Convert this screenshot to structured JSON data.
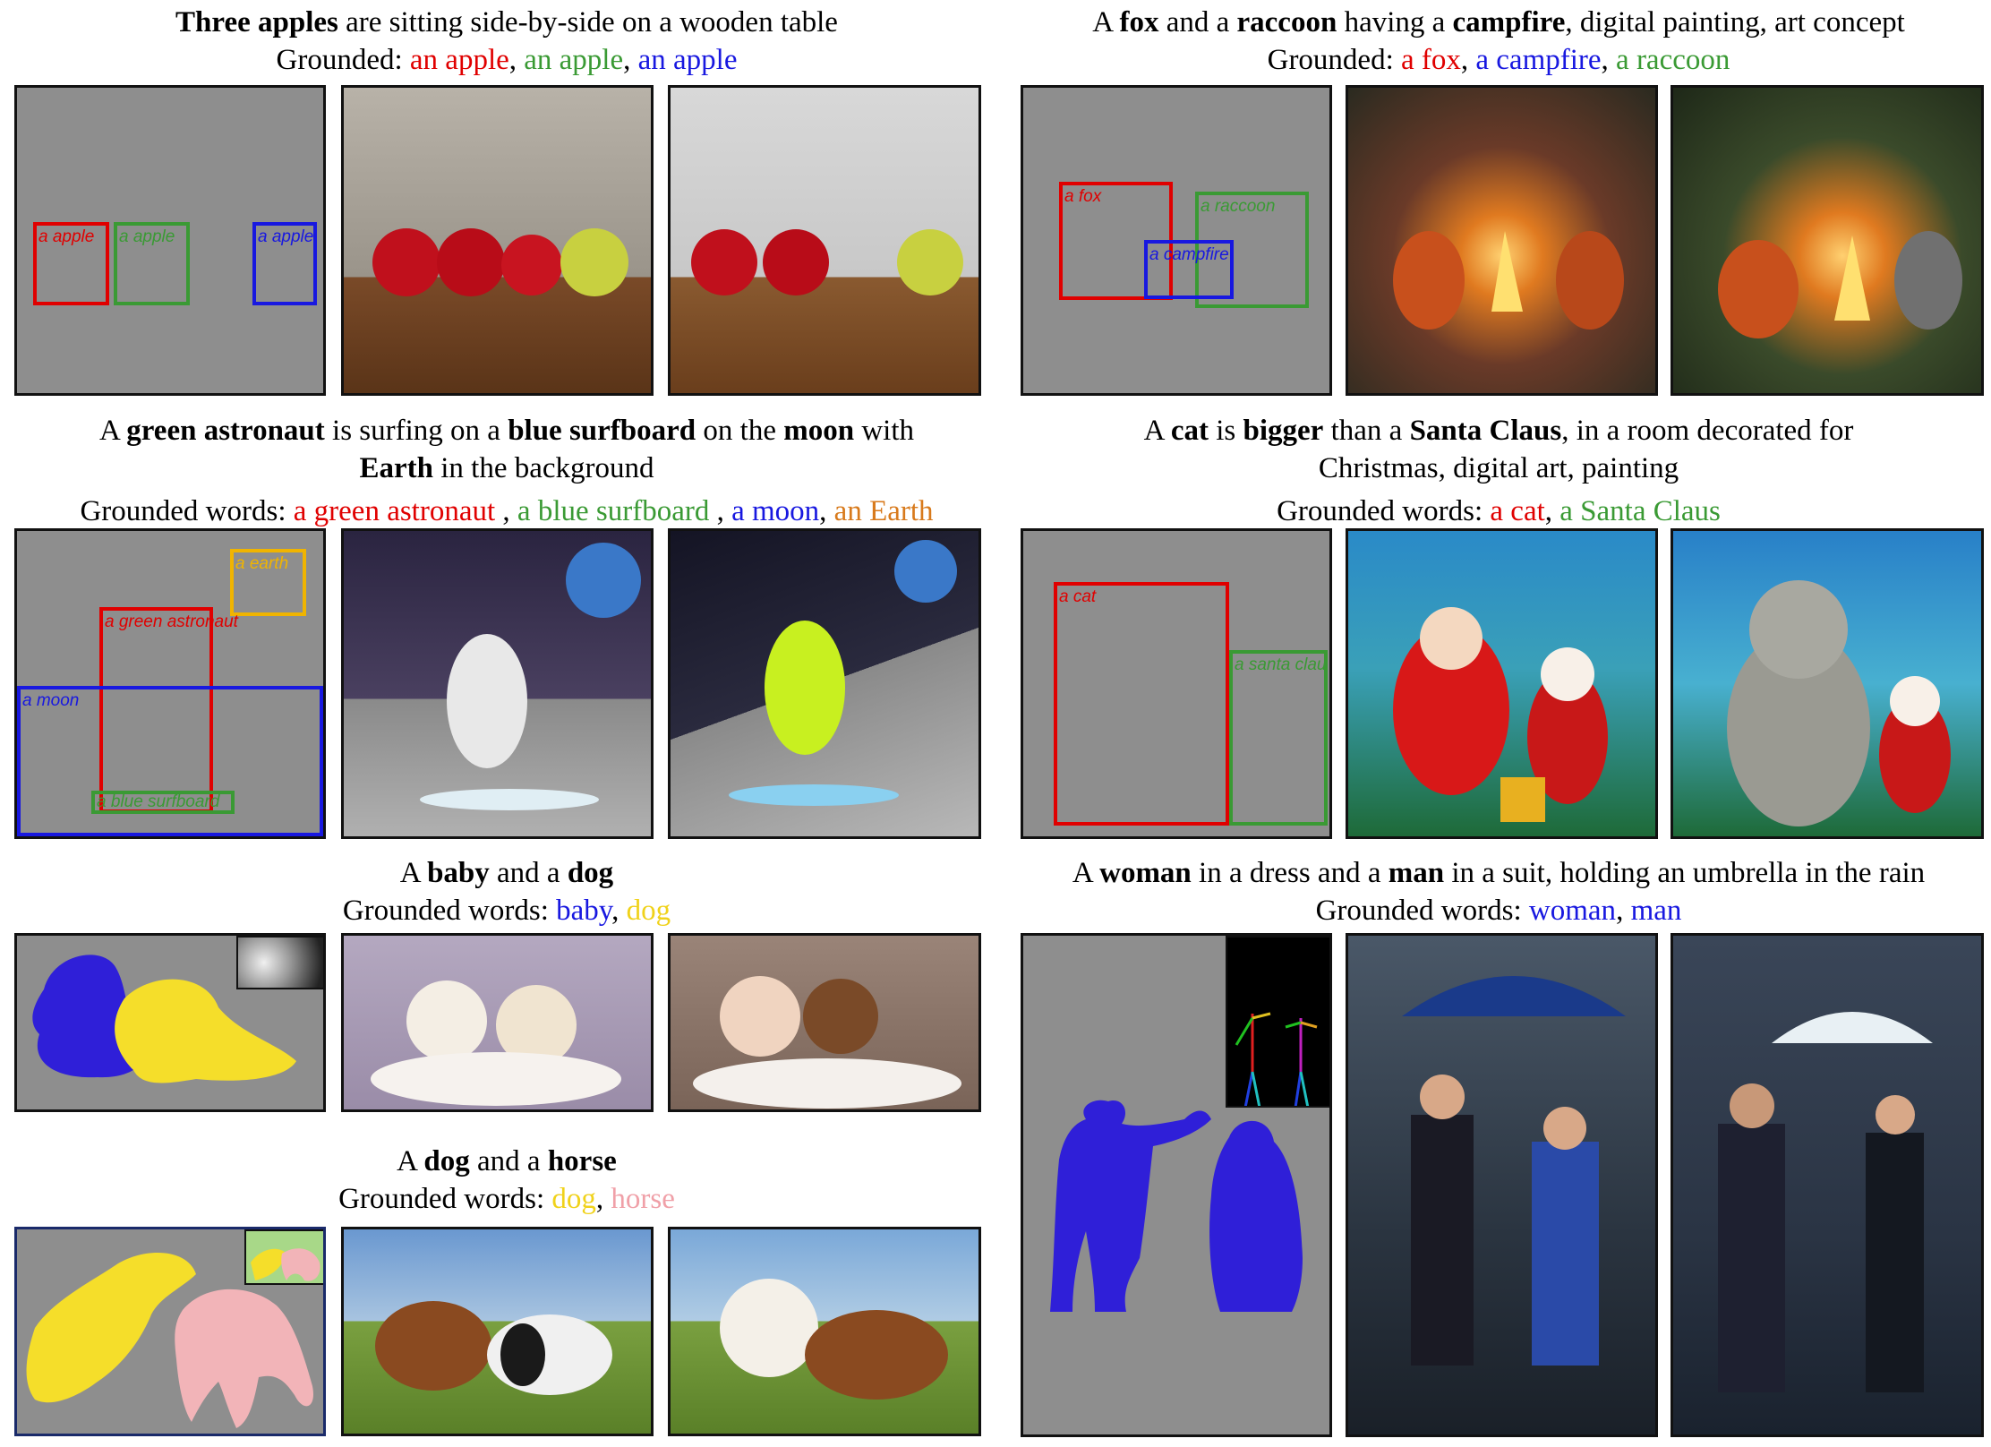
{
  "colors": {
    "red": "#e00000",
    "green": "#3a9a34",
    "blue": "#1818e0",
    "orange": "#d87a1c",
    "yellow": "#f0d21a",
    "pink": "#f0a0a8",
    "panel_gray": "#8e8e8e"
  },
  "p1": {
    "cap_b1": "Three apples",
    "cap_t1": " are sitting side-by-side on a wooden table",
    "g_prefix": "Grounded: ",
    "g1": "an apple",
    "sep1": ", ",
    "g2": "an apple",
    "sep2": ", ",
    "g3": "an apple",
    "box1": "a apple",
    "box2": "a apple",
    "box3": "a apple"
  },
  "p2": {
    "cap_t0": "A ",
    "cap_b1": "fox",
    "cap_t1": " and a ",
    "cap_b2": "raccoon",
    "cap_t2": " having a ",
    "cap_b3": "campfire",
    "cap_t3": ", digital painting, art concept",
    "g_prefix": "Grounded: ",
    "g1": "a fox",
    "sep1": ", ",
    "g2": "a campfire",
    "sep2": ", ",
    "g3": "a raccoon",
    "box1": "a fox",
    "box2": "a raccoon",
    "box3": "a campfire"
  },
  "p3": {
    "cap_t0": "A ",
    "cap_b1": "green astronaut",
    "cap_t1": " is surfing on a ",
    "cap_b2": "blue surfboard",
    "cap_t2": " on the ",
    "cap_b3": "moon",
    "cap_t3": " with",
    "cap2_b1": "Earth",
    "cap2_t1": " in the background",
    "g_prefix": "Grounded words: ",
    "g1": "a green astronaut",
    "sep1": " , ",
    "g2": "a blue surfboard",
    "sep2": " , ",
    "g3": "a moon",
    "sep3": ", ",
    "g4": "an Earth",
    "box1": "a earth",
    "box2": "a green astronaut",
    "box3": "a moon",
    "box4": "a blue  surfboard"
  },
  "p4": {
    "cap_t0": "A ",
    "cap_b1": "cat",
    "cap_t1": " is ",
    "cap_b2": "bigger",
    "cap_t2": " than a ",
    "cap_b3": "Santa Claus",
    "cap_t3": ", in a room decorated for",
    "cap2": "Christmas, digital art, painting",
    "g_prefix": "Grounded words: ",
    "g1": "a cat",
    "sep1": ", ",
    "g2": "a Santa Claus",
    "box1": "a cat",
    "box2": "a santa clau"
  },
  "p5": {
    "cap_t0": "A ",
    "cap_b1": "baby",
    "cap_t1": " and a ",
    "cap_b2": "dog",
    "g_prefix": "Grounded words:  ",
    "g1": "baby",
    "sep1": ", ",
    "g2": "dog"
  },
  "p6": {
    "cap_t0": "A ",
    "cap_b1": "woman",
    "cap_t1": " in a dress and a ",
    "cap_b2": "man",
    "cap_t2": " in a suit, holding an umbrella in the rain",
    "g_prefix": "Grounded words: ",
    "g1": "woman",
    "sep1": ", ",
    "g2": "man"
  },
  "p7": {
    "cap_t0": "A ",
    "cap_b1": "dog",
    "cap_t1": " and a ",
    "cap_b2": "horse",
    "g_prefix": "Grounded words: ",
    "g1": "dog",
    "sep1": ",  ",
    "g2": "horse"
  }
}
